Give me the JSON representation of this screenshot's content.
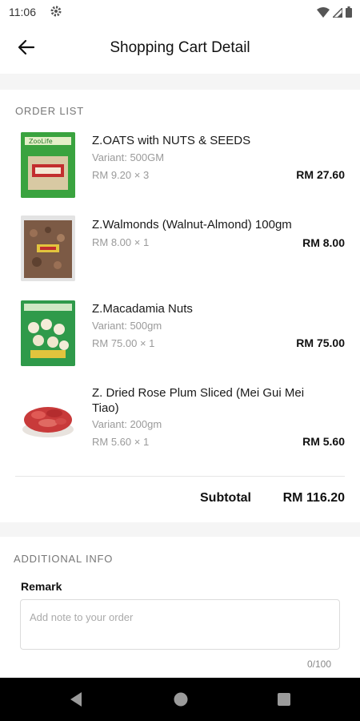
{
  "status_bar": {
    "time": "11:06"
  },
  "header": {
    "title": "Shopping Cart Detail"
  },
  "order_list": {
    "label": "ORDER LIST",
    "items": [
      {
        "name": "Z.OATS with NUTS & SEEDS",
        "variant": "Variant: 500GM",
        "price_qty": "RM 9.20 × 3",
        "total": "RM 27.60"
      },
      {
        "name": "Z.Walmonds (Walnut-Almond) 100gm",
        "variant": "",
        "price_qty": "RM 8.00 × 1",
        "total": "RM 8.00"
      },
      {
        "name": "Z.Macadamia Nuts",
        "variant": "Variant: 500gm",
        "price_qty": "RM 75.00 × 1",
        "total": "RM 75.00"
      },
      {
        "name": "Z. Dried Rose Plum Sliced (Mei Gui Mei Tiao)",
        "variant": "Variant: 200gm",
        "price_qty": "RM 5.60 × 1",
        "total": "RM 5.60"
      }
    ],
    "subtotal_label": "Subtotal",
    "subtotal_value": "RM 116.20"
  },
  "additional_info": {
    "label": "ADDITIONAL INFO",
    "remark_label": "Remark",
    "remark_placeholder": "Add note to your order",
    "remark_value": "",
    "counter": "0/100"
  },
  "icons": {
    "settings": "gear-icon",
    "wifi": "wifi-icon",
    "signal": "signal-icon",
    "battery": "battery-icon",
    "back": "arrow-left-icon",
    "nav_back": "triangle-back-icon",
    "nav_home": "circle-home-icon",
    "nav_recents": "square-recents-icon"
  },
  "colors": {
    "background": "#ffffff",
    "section_band": "#f5f5f5",
    "nav_bar": "#000000"
  }
}
